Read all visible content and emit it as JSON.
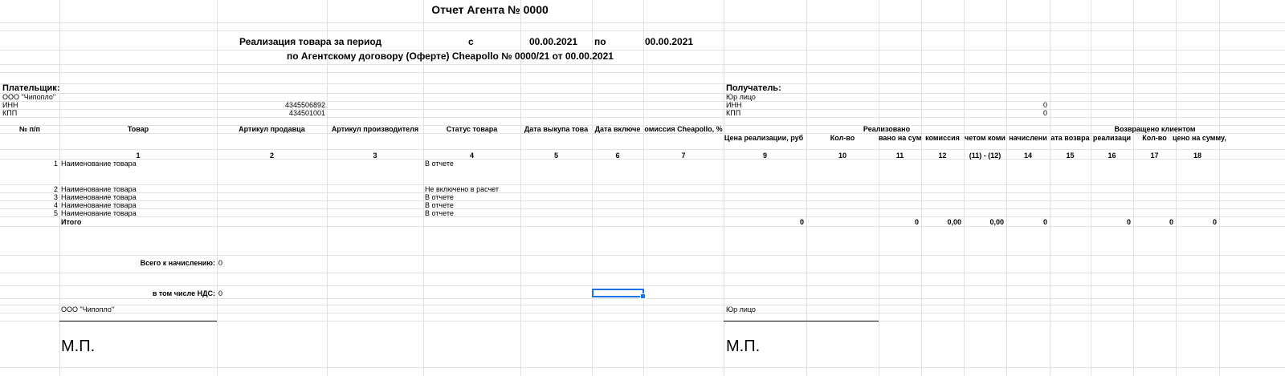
{
  "report": {
    "title": "Отчет Агента № 0000",
    "period_label": "Реализация товара за период",
    "from_label": "с",
    "date_from": "00.00.2021",
    "to_label": "по",
    "date_to": "00.00.2021",
    "contract_line": "по Агентскому договору (Оферте) Cheapollo № 0000/21 от 00.00.2021"
  },
  "payer": {
    "heading": "Плательщик:",
    "name": "ООО \"Чипопло\"",
    "inn_label": "ИНН",
    "inn_value": "4345506892",
    "kpp_label": "КПП",
    "kpp_value": "434501001"
  },
  "recipient": {
    "heading": "Получатель:",
    "name": "Юр лицо",
    "inn_label": "ИНН",
    "inn_value": "0",
    "kpp_label": "КПП",
    "kpp_value": "0"
  },
  "table": {
    "headers": {
      "num": "№ п/п",
      "product": "Товар",
      "seller_sku": "Артикул продавца",
      "maker_sku": "Артикул производителя",
      "status": "Статус товара",
      "buyout_date": "Дата выкупа това",
      "include_date": "Дата включе",
      "commission": "омиссия Cheapollo, %",
      "sold_group": "Реализовано",
      "returned_group": "Возвращено клиентом",
      "sale_price": "Цена реализации, руб",
      "qty": "Кол-во",
      "sold_sum": "вано на сум",
      "commission_sum": "комиссия",
      "net_commission": "четом коми",
      "charged": "начислени",
      "return_date": "ата возвра",
      "ret_price": "реализаци",
      "ret_qty": "Кол-во",
      "ret_sum": "цено на сумму, руб."
    },
    "col_numbers": [
      "1",
      "2",
      "3",
      "4",
      "5",
      "6",
      "7",
      "9",
      "10",
      "11",
      "12",
      "(11) - (12)",
      "14",
      "15",
      "16",
      "17",
      "18"
    ],
    "rows": [
      {
        "num": "1",
        "product": "Наименование товара",
        "status": "В отчете"
      },
      {
        "num": "2",
        "product": "Наименование товара",
        "status": "Не включено в расчет"
      },
      {
        "num": "3",
        "product": "Наименование товара",
        "status": "В отчете"
      },
      {
        "num": "4",
        "product": "Наименование товара",
        "status": "В отчете"
      },
      {
        "num": "5",
        "product": "Наименование товара",
        "status": "В отчете"
      }
    ],
    "total": {
      "label": "Итого",
      "c9": "0",
      "c11": "0",
      "c12": "0,00",
      "c13": "0,00",
      "c14": "0",
      "c16": "0",
      "c17": "0",
      "c18": "0"
    }
  },
  "summary": {
    "to_charge_label": "Всего к начислению:",
    "to_charge_value": "0",
    "vat_label": "в том числе НДС:",
    "vat_value": "0"
  },
  "signatures": {
    "payer_name": "ООО \"Чипопло\"",
    "recipient_name": "Юр лицо",
    "stamp_left": "М.П.",
    "stamp_right": "М.П."
  },
  "colors": {
    "gridline": "#e2e2e2",
    "selection": "#1a73e8"
  }
}
